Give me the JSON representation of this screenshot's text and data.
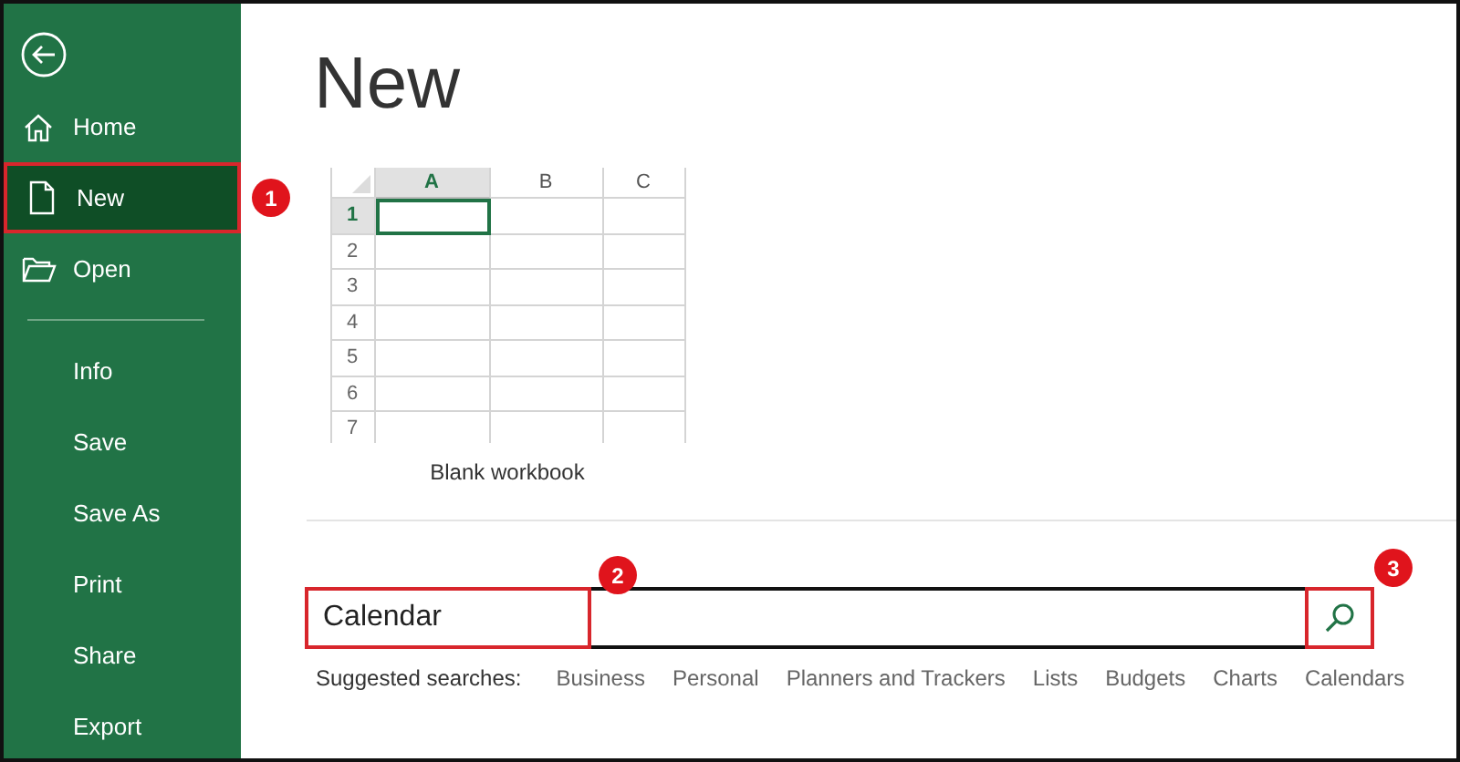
{
  "sidebar": {
    "items": [
      {
        "kind": "icon",
        "label": "Home",
        "selected": false,
        "highlighted": false
      },
      {
        "kind": "icon",
        "label": "New",
        "selected": true,
        "highlighted": true,
        "badge": "1"
      },
      {
        "kind": "icon",
        "label": "Open",
        "selected": false,
        "highlighted": false
      },
      {
        "kind": "divider"
      },
      {
        "kind": "text",
        "label": "Info",
        "selected": false,
        "highlighted": false
      },
      {
        "kind": "text",
        "label": "Save",
        "selected": false,
        "highlighted": false
      },
      {
        "kind": "text",
        "label": "Save As",
        "selected": false,
        "highlighted": false
      },
      {
        "kind": "text",
        "label": "Print",
        "selected": false,
        "highlighted": false
      },
      {
        "kind": "text",
        "label": "Share",
        "selected": false,
        "highlighted": false
      },
      {
        "kind": "text",
        "label": "Export",
        "selected": false,
        "highlighted": false
      }
    ]
  },
  "page_title": "New",
  "template": {
    "caption": "Blank workbook",
    "columns": [
      {
        "label": "A",
        "selected": true
      },
      {
        "label": "B",
        "selected": false
      },
      {
        "label": "C",
        "selected": false
      }
    ],
    "rows": [
      {
        "label": "1",
        "selected": true
      },
      {
        "label": "2",
        "selected": false
      },
      {
        "label": "3",
        "selected": false
      },
      {
        "label": "4",
        "selected": false
      },
      {
        "label": "5",
        "selected": false
      },
      {
        "label": "6",
        "selected": false
      },
      {
        "label": "7",
        "selected": false
      }
    ]
  },
  "search": {
    "value": "Calendar",
    "value_highlighted": true,
    "value_badge": "2",
    "button_highlighted": true,
    "button_badge": "3"
  },
  "suggested": {
    "label": "Suggested searches:",
    "items": [
      "Business",
      "Personal",
      "Planners and Trackers",
      "Lists",
      "Budgets",
      "Charts",
      "Calendars"
    ]
  }
}
